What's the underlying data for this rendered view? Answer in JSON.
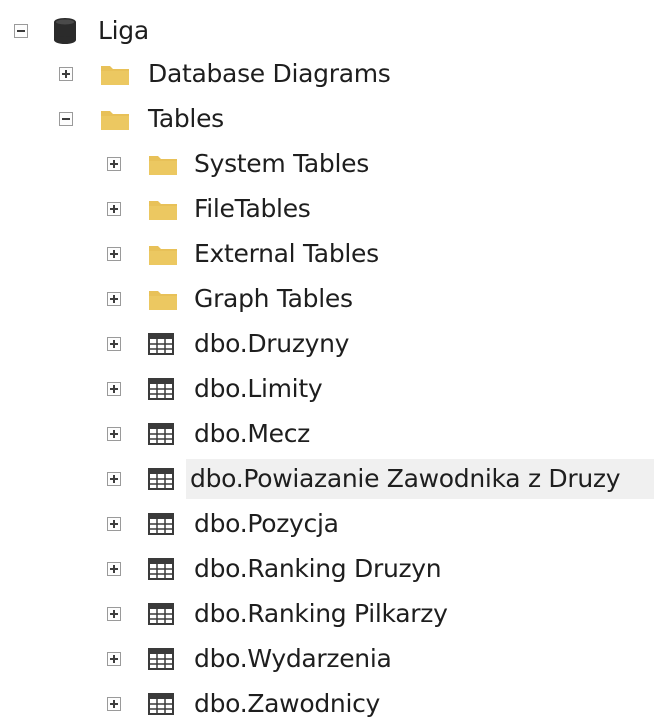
{
  "tree": {
    "root": {
      "label": "Liga",
      "expanded": true,
      "icon": "database-icon"
    },
    "level1": [
      {
        "label": "Database Diagrams",
        "expanded": false,
        "icon": "folder-icon"
      },
      {
        "label": "Tables",
        "expanded": true,
        "icon": "folder-icon"
      }
    ],
    "tables_children": [
      {
        "label": "System Tables",
        "expanded": false,
        "icon": "folder-icon"
      },
      {
        "label": "FileTables",
        "expanded": false,
        "icon": "folder-icon"
      },
      {
        "label": "External Tables",
        "expanded": false,
        "icon": "folder-icon"
      },
      {
        "label": "Graph Tables",
        "expanded": false,
        "icon": "folder-icon"
      },
      {
        "label": "dbo.Druzyny",
        "expanded": false,
        "icon": "table-icon"
      },
      {
        "label": "dbo.Limity",
        "expanded": false,
        "icon": "table-icon"
      },
      {
        "label": "dbo.Mecz",
        "expanded": false,
        "icon": "table-icon"
      },
      {
        "label": "dbo.Powiazanie Zawodnika z Druzy",
        "expanded": false,
        "icon": "table-icon",
        "selected": true
      },
      {
        "label": "dbo.Pozycja",
        "expanded": false,
        "icon": "table-icon"
      },
      {
        "label": "dbo.Ranking Druzyn",
        "expanded": false,
        "icon": "table-icon"
      },
      {
        "label": "dbo.Ranking Pilkarzy",
        "expanded": false,
        "icon": "table-icon"
      },
      {
        "label": "dbo.Wydarzenia",
        "expanded": false,
        "icon": "table-icon"
      },
      {
        "label": "dbo.Zawodnicy",
        "expanded": false,
        "icon": "table-icon"
      }
    ]
  },
  "colors": {
    "folder": "#e8c158",
    "folder_dark": "#d9ac3e",
    "table_border": "#3a3a3a",
    "database": "#2b2b2b",
    "selection": "#f0f0f0"
  }
}
